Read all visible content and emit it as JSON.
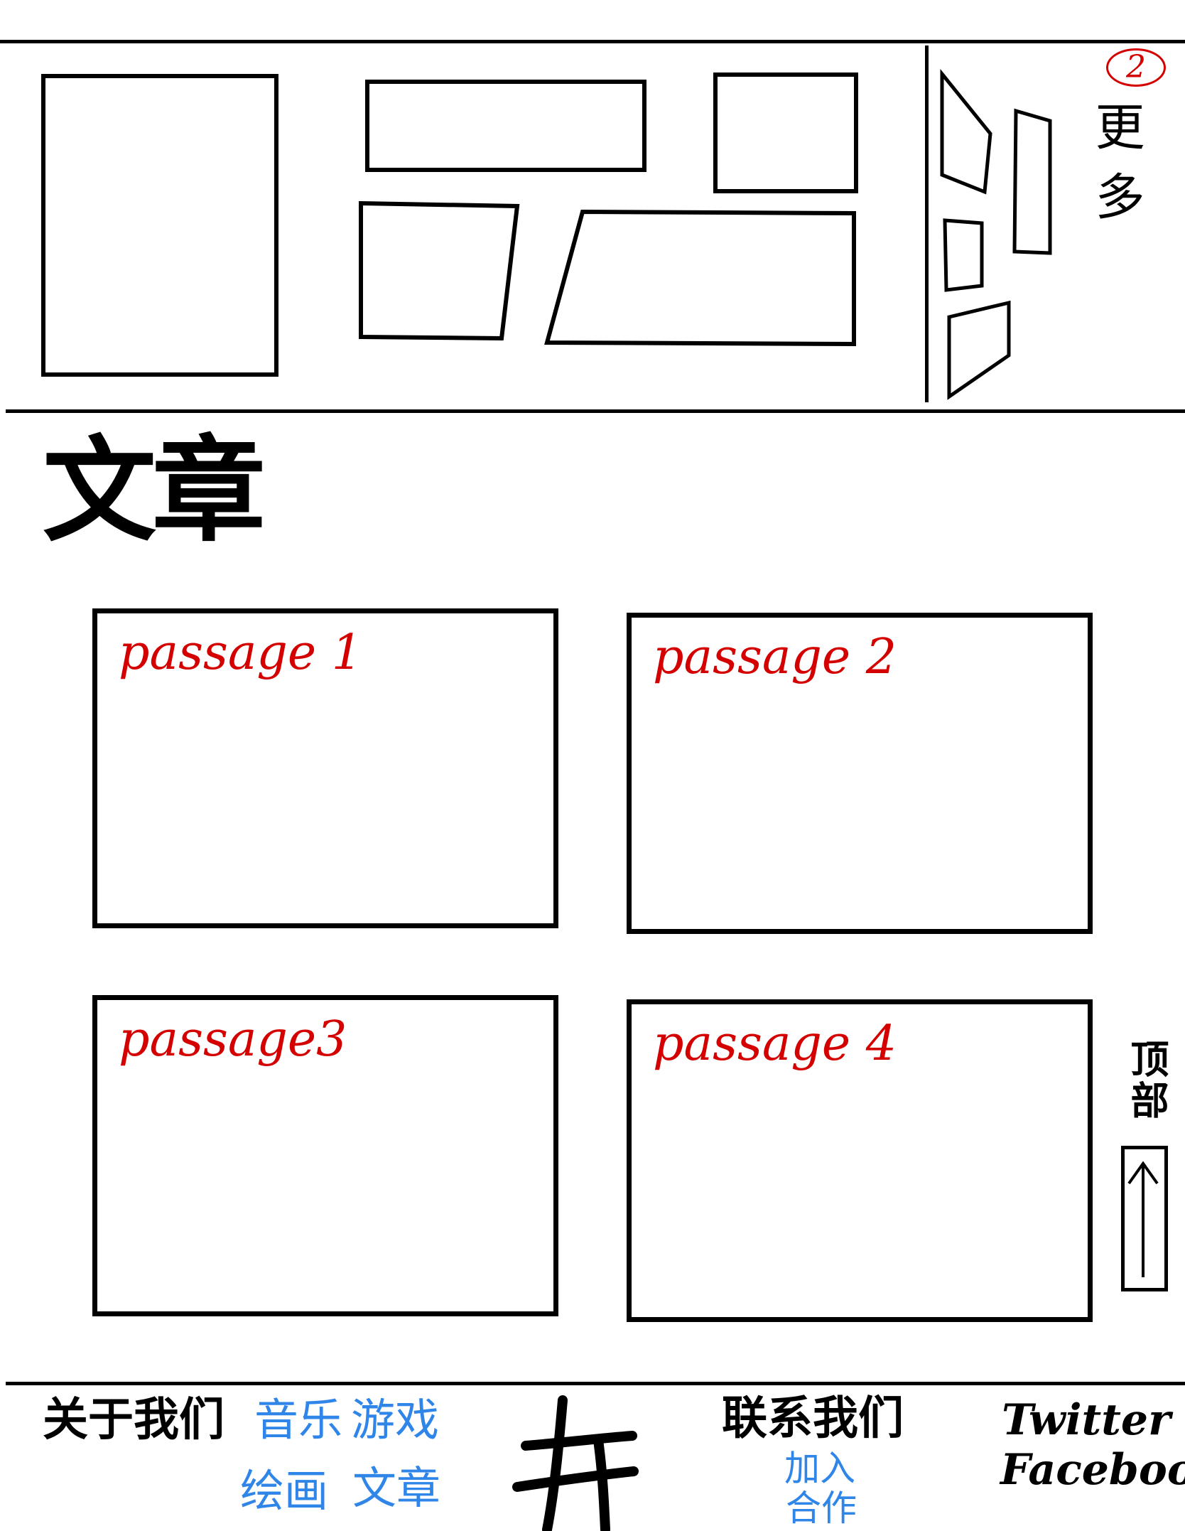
{
  "banner": {
    "more_badge": "2",
    "more_label": "更多"
  },
  "articles": {
    "section_title": "文章",
    "items": [
      {
        "title": "passage 1"
      },
      {
        "title": "passage 2"
      },
      {
        "title": "passage3"
      },
      {
        "title": "passage 4"
      }
    ]
  },
  "back_to_top": {
    "label": "顶部",
    "icon": "arrow-up-icon"
  },
  "footer": {
    "about_heading": "关于我们",
    "about_links": [
      "音乐",
      "游戏",
      "绘画",
      "文章"
    ],
    "logo_icon": "site-logo",
    "contact_heading": "联系我们",
    "contact_links": [
      "加入",
      "合作"
    ],
    "social_links": [
      "Twitter",
      "Facebook"
    ]
  },
  "colors": {
    "title_red": "#d40000",
    "link_blue": "#2f86e8",
    "ink": "#000000"
  }
}
